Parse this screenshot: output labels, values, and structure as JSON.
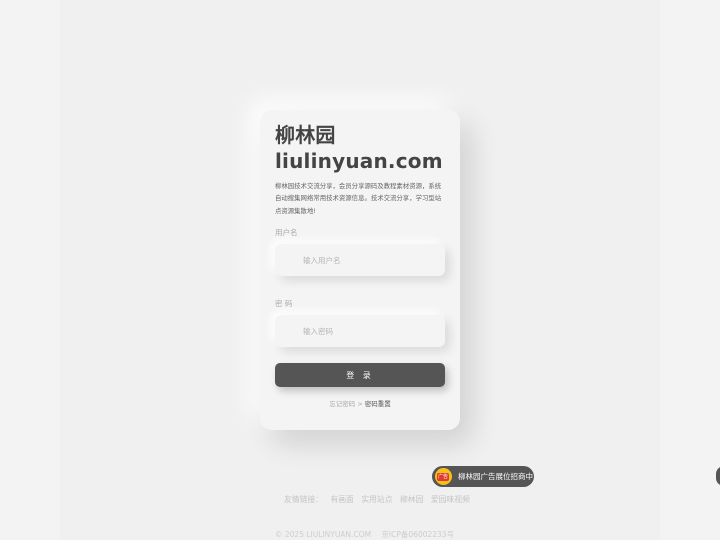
{
  "site": {
    "title_cn": "柳林园",
    "title_domain": "liulinyuan.com",
    "description": "柳林园技术交流分享，会员分享源码及教程素材资源，系统自动搜集网络常用技术资源信息。技术交流分享，学习型站点资源集散地!"
  },
  "form": {
    "username_label": "用户名",
    "username_placeholder": "输入用户名",
    "password_label": "密 码",
    "password_placeholder": "输入密码",
    "login_label": "登 录",
    "forgot_label": "忘记密码",
    "separator": ">",
    "reset_label": "密码重置"
  },
  "ad": {
    "label": "柳林园广告展位招商中",
    "icon": "ad-badge-icon",
    "icon_text": "广告"
  },
  "friend_links": {
    "label": "友情链接：",
    "items": [
      "有画面",
      "实用站点",
      "柳林园",
      "爱园味视频"
    ]
  },
  "footer": {
    "copyright": "© 2025 LIULINYUAN.COM",
    "icp": "京ICP备06002233号"
  },
  "colors": {
    "button": "#555555",
    "card": "#f4f4f4",
    "background": "#f0f0f0"
  }
}
